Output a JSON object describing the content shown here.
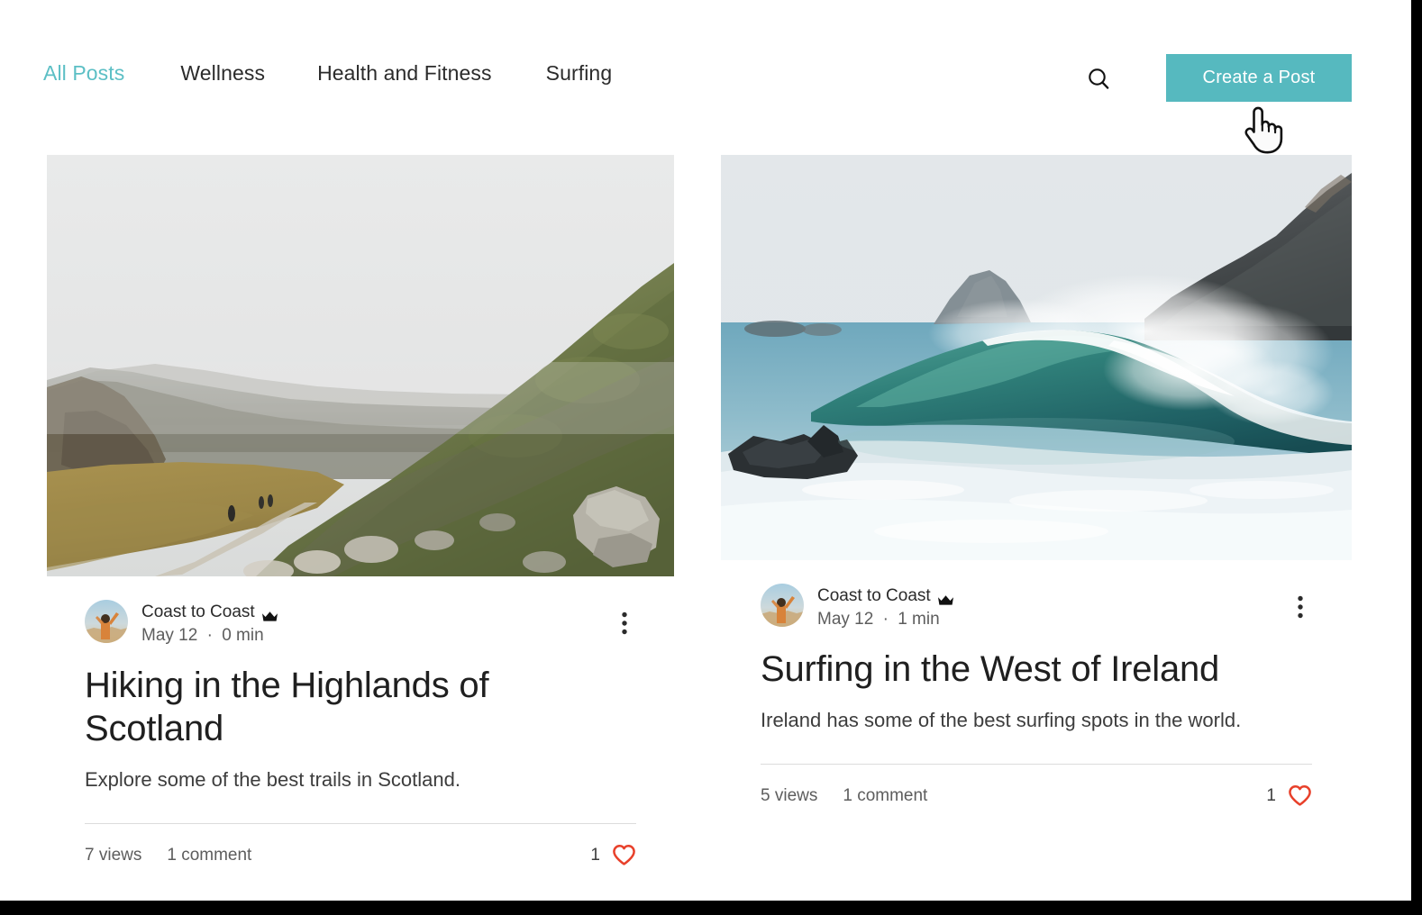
{
  "nav": {
    "items": [
      {
        "label": "All Posts",
        "active": true
      },
      {
        "label": "Wellness",
        "active": false
      },
      {
        "label": "Health and Fitness",
        "active": false
      },
      {
        "label": "Surfing",
        "active": false
      }
    ]
  },
  "header": {
    "search_icon": "search-icon",
    "create_label": "Create a Post",
    "accent_color": "#56b9bf",
    "active_tab_color": "#5cbfc5",
    "cursor": "pointer-hand-cursor"
  },
  "posts": [
    {
      "author": "Coast to Coast",
      "badge": "crown-icon",
      "date": "May 12",
      "separator": "·",
      "readtime": "0 min",
      "title": "Hiking in the Highlands of Scotland",
      "excerpt": "Explore some of the best trails in Scotland.",
      "views": "7 views",
      "comments": "1 comment",
      "likes": "1",
      "like_icon": "heart-icon",
      "like_color": "#e8402a",
      "more_icon": "more-vertical-icon",
      "cover_alt": "misty-mountain-trail-photo"
    },
    {
      "author": "Coast to Coast",
      "badge": "crown-icon",
      "date": "May 12",
      "separator": "·",
      "readtime": "1 min",
      "title": "Surfing in the West of Ireland",
      "excerpt": "Ireland has some of the best surfing spots in the world.",
      "views": "5 views",
      "comments": "1 comment",
      "likes": "1",
      "like_icon": "heart-icon",
      "like_color": "#e8402a",
      "more_icon": "more-vertical-icon",
      "cover_alt": "breaking-ocean-wave-photo"
    }
  ]
}
